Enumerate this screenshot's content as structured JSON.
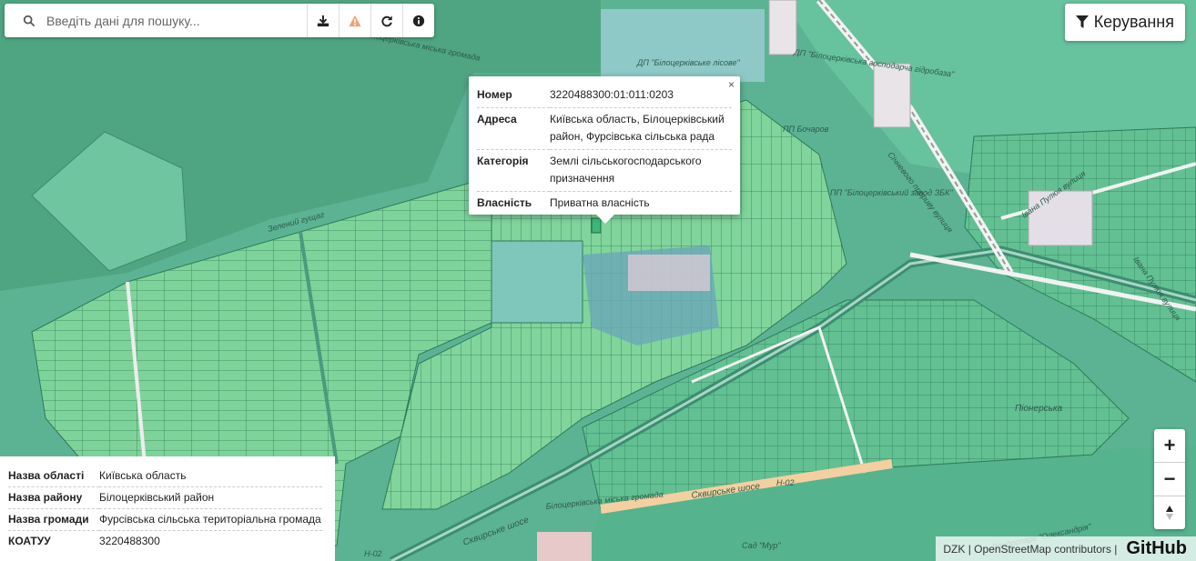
{
  "colors": {
    "map_base": "#6bb89c",
    "forest": "#4fa582",
    "parcel_fill": "#7ed39a",
    "parcel_line": "#2e7a58",
    "road": "#f2f2f2",
    "water": "#8fc9c7",
    "highway": "#f4cfa0"
  },
  "search": {
    "placeholder": "Введіть дані для пошуку..."
  },
  "toolbar": {
    "icons": [
      "download-icon",
      "warning-icon",
      "refresh-icon",
      "info-icon"
    ]
  },
  "control_button": {
    "label": "Керування",
    "icon": "filter-icon"
  },
  "popup": {
    "close_label": "×",
    "rows": [
      {
        "key": "Номер",
        "value": "3220488300:01:011:0203"
      },
      {
        "key": "Адреса",
        "value": "Київська область, Білоцерківський район, Фурсівська сільська рада"
      },
      {
        "key": "Категорія",
        "value": "Землі сільськогосподарського призначення"
      },
      {
        "key": "Власність",
        "value": "Приватна власність"
      }
    ]
  },
  "info_panel": {
    "rows": [
      {
        "key": "Назва області",
        "value": "Київська область"
      },
      {
        "key": "Назва району",
        "value": "Білоцерківський район"
      },
      {
        "key": "Назва громади",
        "value": "Фурсівська сільська територіальна громада"
      },
      {
        "key": "КОАТУУ",
        "value": "3220488300"
      }
    ]
  },
  "zoom": {
    "in_label": "+",
    "out_label": "−",
    "north_icon": "north-arrow-icon"
  },
  "attribution": {
    "text": "DZK | OpenStreetMap contributors |",
    "brand": "GitHub"
  },
  "map_labels": {
    "dp_lisove": "ДП \"Білоцерківське лісове\"",
    "dp_hospodarstvo": "ДП \"Білоцерківська господарча гідробаза\"",
    "pp_bocharov": "ПП Бочаров",
    "zavod": "ПП \"Білоцерківський завод ЗБК\"",
    "street_1": "Січневого прориву вулиця",
    "street_2": "Івана Пулюя вулиця",
    "street_3": "Зелений гущаг",
    "street_4": "Івана Пулюя вулиця",
    "skvyrske_1": "Сквирське шосе",
    "skvyrske_2": "Сквирське шосе",
    "h02_1": "Н-02",
    "h02_2": "Н-02",
    "hromada_1": "Білоцерківська міська громада",
    "hromada_2": "Білоцерківська міська громада",
    "sad": "Сад \"Мур\"",
    "park": "Дендропарк \"Олександрія\"",
    "pionerska": "Піонерська"
  }
}
